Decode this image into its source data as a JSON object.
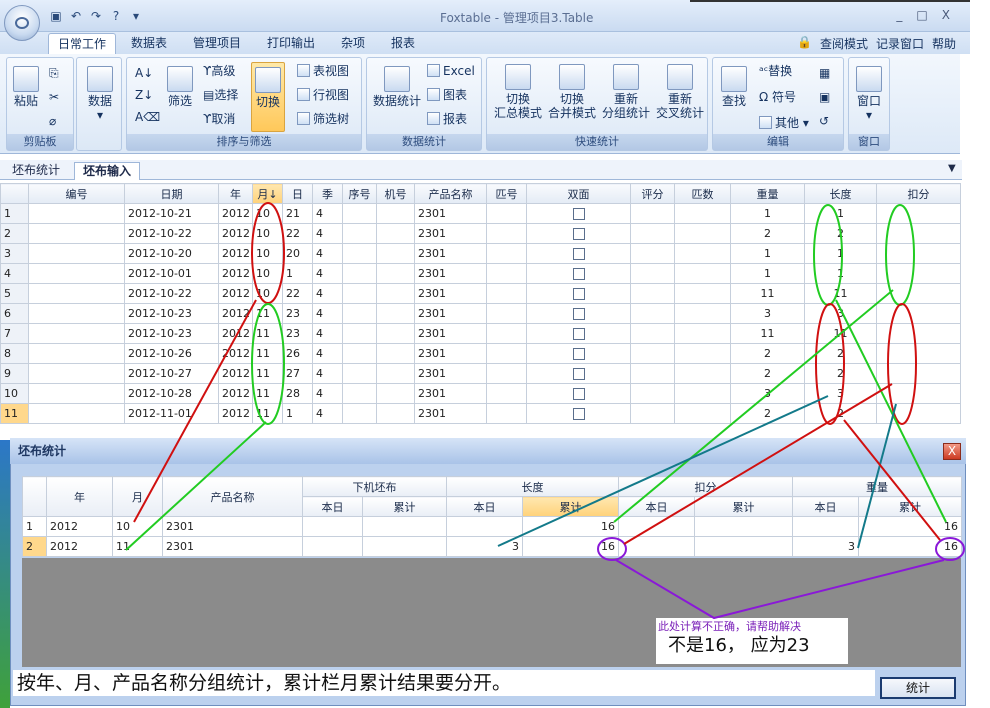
{
  "app": {
    "title": "Foxtable - 管理项目3.Table",
    "window_buttons": [
      "_",
      "□",
      "X"
    ]
  },
  "menu": {
    "tabs": [
      "日常工作",
      "数据表",
      "管理项目",
      "打印输出",
      "杂项",
      "报表"
    ],
    "right": [
      "查阅模式",
      "记录窗口",
      "帮助"
    ]
  },
  "ribbon": {
    "clipboard": {
      "label": "剪贴板",
      "paste": "粘贴"
    },
    "data": {
      "label": "数据"
    },
    "sort": {
      "label": "排序与筛选",
      "filter": "筛选",
      "advanced": "高级",
      "select": "选择",
      "cancel": "取消",
      "toggle": "切换",
      "tableview": "表视图",
      "rowview": "行视图",
      "filtertree": "筛选树"
    },
    "stats": {
      "label": "数据统计",
      "main": "数据统计",
      "excel": "Excel",
      "chart": "图表",
      "report": "报表"
    },
    "quick": {
      "label": "快速统计",
      "b1a": "切换",
      "b1b": "汇总模式",
      "b2a": "切换",
      "b2b": "合并模式",
      "b3a": "重新",
      "b3b": "分组统计",
      "b4a": "重新",
      "b4b": "交叉统计"
    },
    "edit": {
      "label": "编辑",
      "find": "查找",
      "replace": "替换",
      "symbol": "符号",
      "other": "其他"
    },
    "window": {
      "label": "窗口",
      "main": "窗口"
    }
  },
  "doc_tabs": [
    "坯布统计",
    "坯布输入"
  ],
  "grid1": {
    "headers": [
      "",
      "编号",
      "日期",
      "年",
      "月↓",
      "日",
      "季",
      "序号",
      "机号",
      "产品名称",
      "匹号",
      "双面",
      "评分",
      "匹数",
      "重量",
      "长度",
      "扣分"
    ],
    "rows": [
      {
        "n": "1",
        "date": "2012-10-21",
        "y": "2012",
        "m": "10",
        "d": "21",
        "q": "4",
        "p": "2301",
        "w": "1",
        "l": "1"
      },
      {
        "n": "2",
        "date": "2012-10-22",
        "y": "2012",
        "m": "10",
        "d": "22",
        "q": "4",
        "p": "2301",
        "w": "2",
        "l": "2"
      },
      {
        "n": "3",
        "date": "2012-10-20",
        "y": "2012",
        "m": "10",
        "d": "20",
        "q": "4",
        "p": "2301",
        "w": "1",
        "l": "1"
      },
      {
        "n": "4",
        "date": "2012-10-01",
        "y": "2012",
        "m": "10",
        "d": "1",
        "q": "4",
        "p": "2301",
        "w": "1",
        "l": "1"
      },
      {
        "n": "5",
        "date": "2012-10-22",
        "y": "2012",
        "m": "10",
        "d": "22",
        "q": "4",
        "p": "2301",
        "w": "11",
        "l": "11"
      },
      {
        "n": "6",
        "date": "2012-10-23",
        "y": "2012",
        "m": "11",
        "d": "23",
        "q": "4",
        "p": "2301",
        "w": "3",
        "l": "3"
      },
      {
        "n": "7",
        "date": "2012-10-23",
        "y": "2012",
        "m": "11",
        "d": "23",
        "q": "4",
        "p": "2301",
        "w": "11",
        "l": "11"
      },
      {
        "n": "8",
        "date": "2012-10-26",
        "y": "2012",
        "m": "11",
        "d": "26",
        "q": "4",
        "p": "2301",
        "w": "2",
        "l": "2"
      },
      {
        "n": "9",
        "date": "2012-10-27",
        "y": "2012",
        "m": "11",
        "d": "27",
        "q": "4",
        "p": "2301",
        "w": "2",
        "l": "2"
      },
      {
        "n": "10",
        "date": "2012-10-28",
        "y": "2012",
        "m": "11",
        "d": "28",
        "q": "4",
        "p": "2301",
        "w": "3",
        "l": "3"
      },
      {
        "n": "11",
        "date": "2012-11-01",
        "y": "2012",
        "m": "11",
        "d": "1",
        "q": "4",
        "p": "2301",
        "w": "2",
        "l": "2"
      }
    ]
  },
  "dialog": {
    "title": "坯布统计",
    "close": "X",
    "headers": {
      "year": "年",
      "month": "月",
      "product": "产品名称",
      "g1": "下机坯布",
      "g2": "长度",
      "g3": "扣分",
      "g4": "重量",
      "today": "本日",
      "cum": "累计"
    },
    "rows": [
      {
        "n": "1",
        "y": "2012",
        "m": "10",
        "p": "2301",
        "len_today": "",
        "len_cum": "16",
        "w_today": "",
        "w_cum": "16"
      },
      {
        "n": "2",
        "y": "2012",
        "m": "11",
        "p": "2301",
        "len_today": "3",
        "len_cum": "16",
        "w_today": "3",
        "w_cum": "16"
      }
    ],
    "note_small": "此处计算不正确，请帮助解决",
    "note_big": "不是16，  应为23",
    "footer": "按年、月、产品名称分组统计，累计栏月累计结果要分开。",
    "stat_button": "统计"
  }
}
